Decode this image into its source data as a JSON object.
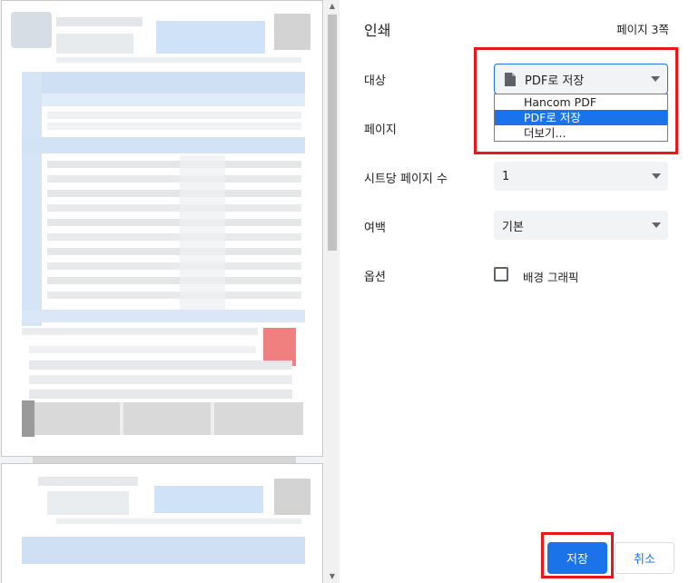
{
  "settings": {
    "title": "인쇄",
    "page_count": "페이지 3쪽",
    "destination": {
      "label": "대상",
      "value": "PDF로 저장",
      "icon": "file-icon",
      "options": [
        "Hancom PDF",
        "PDF로 저장",
        "더보기..."
      ],
      "selected_index": 1
    },
    "pages": {
      "label": "페이지"
    },
    "pages_per_sheet": {
      "label": "시트당 페이지 수",
      "value": "1"
    },
    "margins": {
      "label": "여백",
      "value": "기본"
    },
    "options": {
      "label": "옵션",
      "background_graphics": "배경 그래픽",
      "checked": false
    },
    "buttons": {
      "save": "저장",
      "cancel": "취소"
    }
  },
  "colors": {
    "accent": "#1a73e8",
    "highlight": "#e8171a",
    "select_bg": "#f1f3f4"
  }
}
